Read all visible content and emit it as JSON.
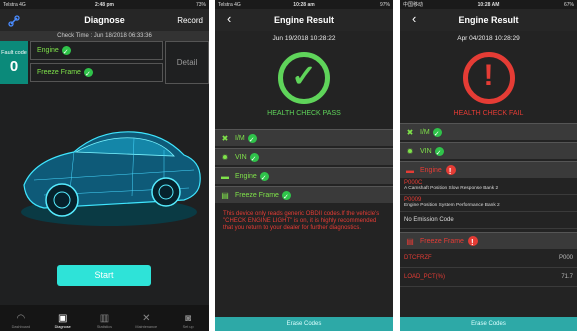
{
  "screen1": {
    "status": {
      "carrier": "Telstra 4G",
      "time": "2:48 pm",
      "battery": "73%"
    },
    "nav": {
      "title": "Diagnose",
      "record": "Record"
    },
    "check_time": "Check Time : Jun 18/2018 06:33:36",
    "fault": {
      "label": "Fault code",
      "count": "0",
      "engine": "Engine",
      "freeze": "Freeze Frame",
      "detail": "Detail"
    },
    "start": "Start",
    "tabs": [
      "Dashboard",
      "Diagnose",
      "Statistics",
      "Maintenance",
      "Set up"
    ]
  },
  "screen2": {
    "status": {
      "carrier": "Telstra 4G",
      "time": "10:28 am",
      "battery": "97%"
    },
    "title": "Engine Result",
    "date": "Jun 19/2018 10:28:22",
    "status_text": "HEALTH CHECK PASS",
    "checks": [
      "I/M",
      "VIN",
      "Engine",
      "Freeze Frame"
    ],
    "note": "This device only reads generic OBDII codes.If the vehicle's \"CHECK ENGINE LIGHT\" is on, it is highly recommended that you return to your dealer for further diagnostics.",
    "erase": "Erase Codes"
  },
  "screen3": {
    "status": {
      "carrier": "中国移动",
      "time": "10:28 AM",
      "battery": "67%"
    },
    "title": "Engine Result",
    "date": "Apr 04/2018 10:28:29",
    "status_text": "HEALTH CHECK FAIL",
    "checks": [
      "I/M",
      "VIN",
      "Engine"
    ],
    "dtcs": [
      {
        "code": "P000C",
        "desc": "A Camshaft Position Slow Response Bank 2"
      },
      {
        "code": "P0009",
        "desc": "Engine Position System Performance Bank 2"
      }
    ],
    "no_emission": "No Emission Code",
    "freeze": "Freeze Frame",
    "rows": [
      {
        "k": "DTCFRZF",
        "v": "P000"
      },
      {
        "k": "LOAD_PCT(%)",
        "v": "71.7"
      }
    ],
    "erase": "Erase Codes"
  }
}
